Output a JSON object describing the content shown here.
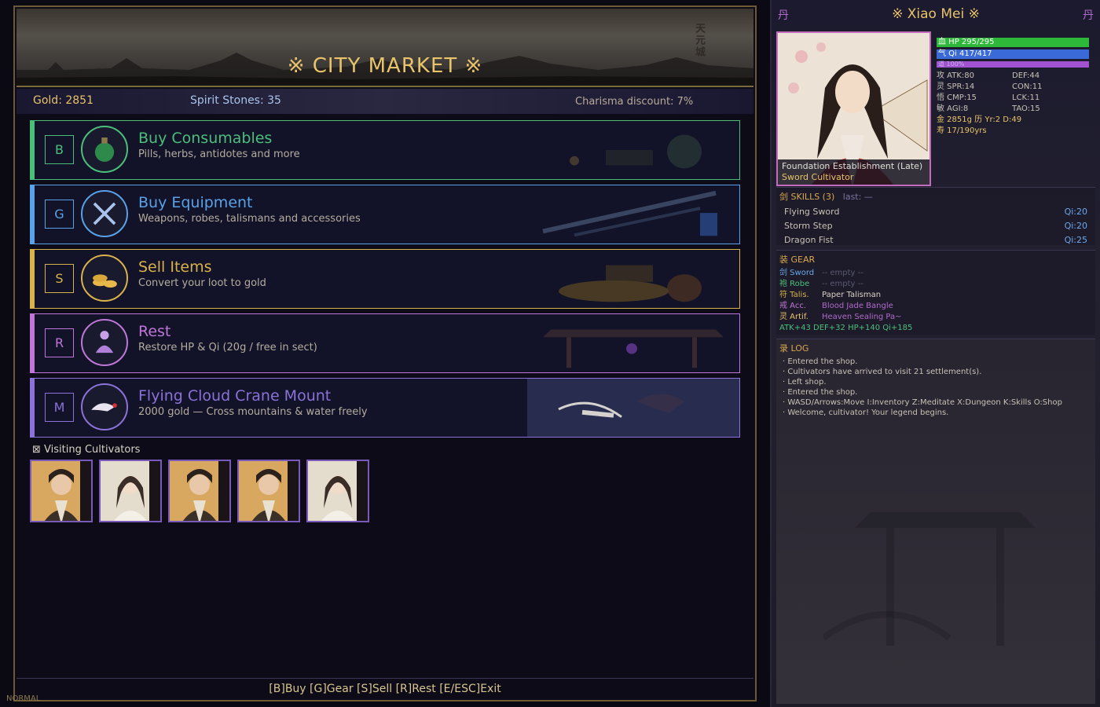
{
  "market": {
    "title": "※ CITY MARKET ※",
    "banner_calligraphy": "天元城",
    "gold": "Gold: 2851",
    "spirit_stones": "Spirit Stones: 35",
    "charisma": "Charisma discount: 7%",
    "options": [
      {
        "key": "B",
        "label": "Buy Consumables",
        "sub": "Pills, herbs, antidotes and more",
        "color": "#4bbf7a",
        "icon": "potion-icon"
      },
      {
        "key": "G",
        "label": "Buy Equipment",
        "sub": "Weapons, robes, talismans and accessories",
        "color": "#5aa2e8",
        "icon": "crossed-swords-icon"
      },
      {
        "key": "S",
        "label": "Sell Items",
        "sub": "Convert your loot to gold",
        "color": "#d8b24a",
        "icon": "coins-icon"
      },
      {
        "key": "R",
        "label": "Rest",
        "sub": "Restore HP & Qi (20g / free in sect)",
        "color": "#c076d8",
        "icon": "meditation-icon"
      },
      {
        "key": "M",
        "label": "Flying Cloud Crane Mount",
        "sub": "2000 gold — Cross mountains & water freely",
        "color": "#8a72d8",
        "icon": "crane-icon"
      }
    ],
    "visitors_label": "Visiting Cultivators",
    "visitors_icon": "sword-square-icon",
    "help": "[B]Buy  [G]Gear  [S]Sell  [R]Rest  [E/ESC]Exit",
    "mode": "NORMAL"
  },
  "side": {
    "dan": "丹",
    "name": "※ Xiao Mei ※",
    "realm": "Foundation Establishment (Late)",
    "class": "Sword Cultivator",
    "hp": "血 HP 295/295",
    "qi": "气 Qi 417/417",
    "tao": "道 100%",
    "stats": [
      [
        "攻 ATK:80",
        "DEF:44"
      ],
      [
        "灵 SPR:14",
        "CON:11"
      ],
      [
        "悟 CMP:15",
        "LCK:11"
      ],
      [
        "敏 AGI:8",
        "TAO:15"
      ]
    ],
    "gold_line": "金 2851g 历 Yr:2 D:49",
    "life": "寿 17/190yrs",
    "skills_header": "剑 SKILLS (3)",
    "skills_last": "last: —",
    "skills": [
      {
        "name": "Flying Sword",
        "cost": "Qi:20"
      },
      {
        "name": "Storm Step",
        "cost": "Qi:20"
      },
      {
        "name": "Dragon Fist",
        "cost": "Qi:25"
      }
    ],
    "gear_header": "装 GEAR",
    "gear": [
      {
        "slot": "剑 Sword",
        "item": "-- empty --",
        "slot_color": "#6aa8ec",
        "item_color": "#5a5870"
      },
      {
        "slot": "袍 Robe",
        "item": "-- empty --",
        "slot_color": "#4bbf7a",
        "item_color": "#5a5870"
      },
      {
        "slot": "符 Talis.",
        "item": "Paper Talisman",
        "slot_color": "#d8b24a",
        "item_color": "#d8d2c4"
      },
      {
        "slot": "戒 Acc.",
        "item": "Blood Jade Bangle",
        "slot_color": "#c076d8",
        "item_color": "#b06acc"
      },
      {
        "slot": "灵 Artif.",
        "item": "Heaven Sealing Pa~",
        "slot_color": "#e8c36a",
        "item_color": "#b06acc"
      }
    ],
    "gear_totals": "ATK+43  DEF+32  HP+140  Qi+185",
    "log_header": "录 LOG",
    "log": [
      "· Entered the shop.",
      "· Cultivators have arrived to visit 21 settlement(s).",
      "· Left shop.",
      "· Entered the shop.",
      "· WASD/Arrows:Move  I:Inventory  Z:Meditate  X:Dungeon  K:Skills  O:Shop",
      "· Welcome, cultivator! Your legend begins."
    ]
  }
}
